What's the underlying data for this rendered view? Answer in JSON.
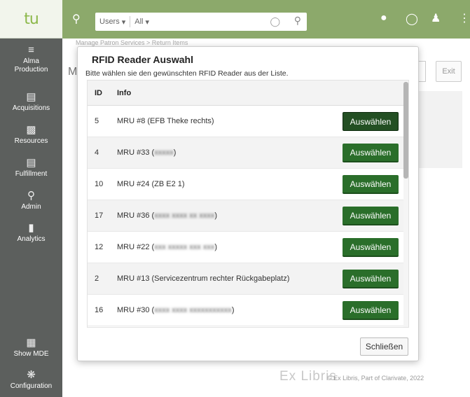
{
  "sidebar": {
    "logo": "tu",
    "items": [
      {
        "label_line1": "Alma",
        "label_line2": "Production"
      },
      {
        "label": "Acquisitions"
      },
      {
        "label": "Resources"
      },
      {
        "label": "Fulfillment"
      },
      {
        "label": "Admin"
      },
      {
        "label": "Analytics"
      },
      {
        "label": "Show MDE"
      },
      {
        "label": "Configuration"
      }
    ]
  },
  "topbar": {
    "search_scope": "Users",
    "search_filter": "All"
  },
  "background": {
    "breadcrumb": "Manage Patron Services  >  Return Items",
    "title_char": "M",
    "exit_label": "Exit"
  },
  "modal": {
    "title": "RFID Reader Auswahl",
    "subtitle": "Bitte wählen sie den gewünschten RFID Reader aus der Liste.",
    "columns": [
      "ID",
      "Info"
    ],
    "rows": [
      {
        "id": "5",
        "info_prefix": "MRU #8 (EFB Theke rechts)",
        "info_blur": "",
        "info_suffix": "",
        "button": "Auswählen"
      },
      {
        "id": "4",
        "info_prefix": "MRU #33 (",
        "info_blur": "xxxxx",
        "info_suffix": ")",
        "button": "Auswählen"
      },
      {
        "id": "10",
        "info_prefix": "MRU #24 (ZB E2 1)",
        "info_blur": "",
        "info_suffix": "",
        "button": "Auswählen"
      },
      {
        "id": "17",
        "info_prefix": "MRU #36 (",
        "info_blur": "xxxx xxxx xx xxxx",
        "info_suffix": ")",
        "button": "Auswählen"
      },
      {
        "id": "12",
        "info_prefix": "MRU #22 (",
        "info_blur": "xxx xxxxx xxx xxx",
        "info_suffix": ")",
        "button": "Auswählen"
      },
      {
        "id": "2",
        "info_prefix": "MRU #13 (Servicezentrum rechter Rückgabeplatz)",
        "info_blur": "",
        "info_suffix": "",
        "button": "Auswählen"
      },
      {
        "id": "16",
        "info_prefix": "MRU #30 (",
        "info_blur": "xxxx xxxx xxxxxxxxxxx",
        "info_suffix": ")",
        "button": "Auswählen"
      }
    ],
    "close_label": "Schließen"
  },
  "footer": {
    "brand": "Ex Libris",
    "copyright": "© Ex Libris, Part of Clarivate,  2022"
  }
}
